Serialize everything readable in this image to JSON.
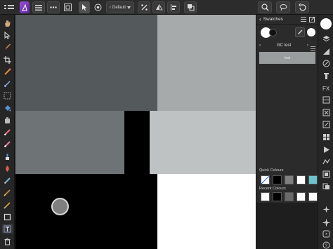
{
  "toolbar": {
    "context_label": "Default",
    "dropdown_caret": "‹"
  },
  "swatches_panel": {
    "title": "Swatches",
    "palette_name": "GC test",
    "palette_prev": "‹",
    "palette_next": "›",
    "swatch_preview_label": "test",
    "quick_colours_label": "Quick Colours",
    "recent_colours_label": "Recent Colours",
    "quick_colours": [
      "none",
      "#000000",
      "#808080",
      "#ffffff",
      "#6cc4cf"
    ],
    "recent_colours": [
      "#ffffff",
      "#000000",
      "#6a6a6a",
      "#ffffff",
      "#ffffff"
    ]
  },
  "canvas": {
    "colors": {
      "dark_gray": "#545a5c",
      "mid_gray": "#6e7375",
      "light_gray": "#a7aaab",
      "lighter_gray": "#bfc2c3",
      "black": "#000000",
      "white": "#ffffff"
    }
  },
  "icons": {
    "left": [
      "hand-icon",
      "move-icon",
      "paint-brush-icon",
      "crop-icon",
      "eyedropper-icon",
      "selection-brush-icon",
      "marquee-icon",
      "flood-fill-icon",
      "clone-icon",
      "erase-brush-icon",
      "healing-icon",
      "burn-icon",
      "dodge-icon",
      "blur-icon",
      "sharpen-icon",
      "pen-icon",
      "rectangle-icon",
      "text-icon",
      "trash-icon"
    ],
    "right": [
      "layers-icon",
      "adjustments-icon",
      "channels-icon",
      "brushes-icon",
      "effects-icon",
      "history-icon",
      "navigator-icon",
      "transform-icon",
      "histogram-icon",
      "stock-icon",
      "macro-icon",
      "library-icon",
      "assets-icon",
      "swatches-icon",
      "snapping-icon",
      "help-icon"
    ]
  }
}
